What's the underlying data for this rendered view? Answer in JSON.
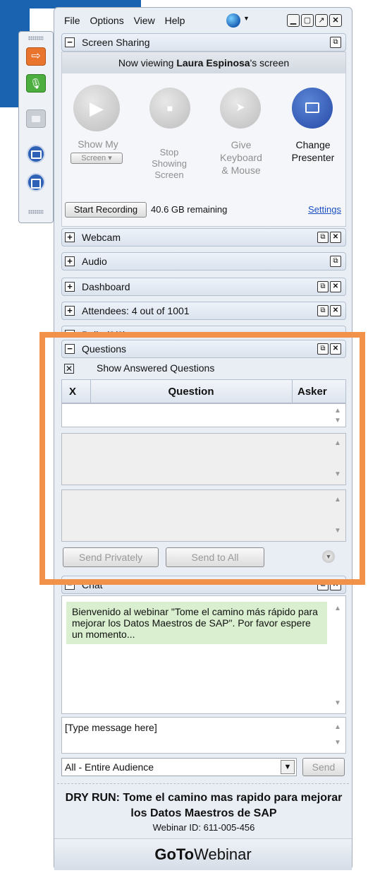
{
  "menu": [
    "File",
    "Options",
    "View",
    "Help"
  ],
  "window_controls": [
    "minimize",
    "restore",
    "popout",
    "close"
  ],
  "screen_sharing": {
    "title": "Screen Sharing",
    "viewing_prefix": "Now viewing ",
    "viewing_name": "Laura Espinosa",
    "viewing_suffix": "'s screen",
    "show_my": "Show My",
    "screen_select": "Screen",
    "stop_showing": [
      "Stop",
      "Showing",
      "Screen"
    ],
    "give_keyboard": [
      "Give",
      "Keyboard",
      "& Mouse"
    ],
    "change_presenter": [
      "Change",
      "Presenter"
    ],
    "start_recording": "Start Recording",
    "remaining": "40.6 GB remaining",
    "settings": "Settings"
  },
  "panels": {
    "webcam": "Webcam",
    "audio": "Audio",
    "dashboard": "Dashboard",
    "attendees": "Attendees:  4 out of 1001",
    "polls": "Polls (0/0)"
  },
  "questions": {
    "title": "Questions",
    "show_answered": "Show Answered Questions",
    "col_x": "X",
    "col_question": "Question",
    "col_asker": "Asker",
    "send_privately": "Send Privately",
    "send_to_all": "Send to All"
  },
  "chat": {
    "title": "Chat",
    "message": "Bienvenido al webinar \"Tome el camino más rápido para mejorar los Datos Maestros de SAP\". Por favor espere un momento...",
    "input_placeholder": "[Type message here]",
    "audience": "All - Entire Audience",
    "send": "Send"
  },
  "footer": {
    "title": "DRY RUN: Tome el camino mas rapido para mejorar los Datos Maestros de SAP",
    "webinar_id": "Webinar ID: 611-005-456",
    "brand_bold": "GoTo",
    "brand_light": "Webinar"
  },
  "colors": {
    "accent_blue": "#1a63b0",
    "highlight_orange": "#f2924a",
    "chat_bg": "#d9efcf",
    "presenter_blue": "#2f62b7"
  }
}
